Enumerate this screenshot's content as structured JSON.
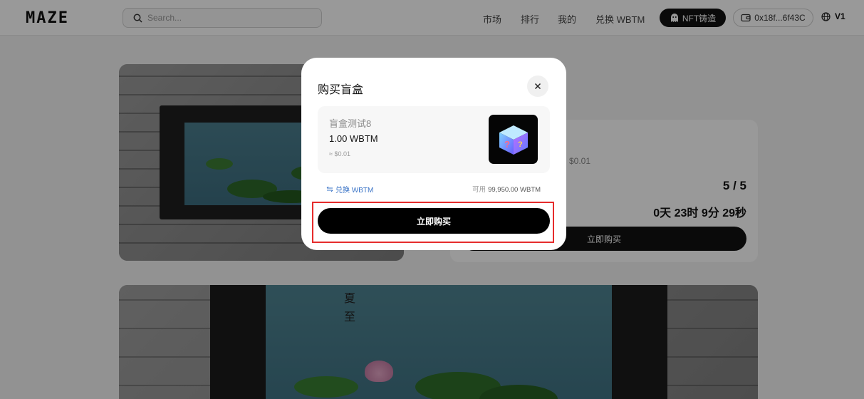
{
  "header": {
    "logo": "MAZE",
    "search_placeholder": "Search...",
    "nav": [
      "市场",
      "排行",
      "我的",
      "兑换 WBTM"
    ],
    "mint_label": "NFT铸造",
    "wallet_address": "0x18f...6f43C",
    "language": "V1"
  },
  "background_card": {
    "price_usd": "$0.01",
    "count": "5 / 5",
    "countdown": "0天 23时 9分 29秒",
    "buy_label": "立即购买"
  },
  "modal": {
    "title": "购买盲盒",
    "item": {
      "name": "盲盒测试8",
      "price": "1.00 WBTM",
      "usd_estimate": "≈ $0.01"
    },
    "swap_link": "兑换 WBTM",
    "balance_label": "可用",
    "balance_value": "99,950.00 WBTM",
    "buy_label": "立即购买"
  },
  "colors": {
    "accent": "#111111",
    "link": "#3b74c7",
    "highlight": "#e62c2c"
  }
}
